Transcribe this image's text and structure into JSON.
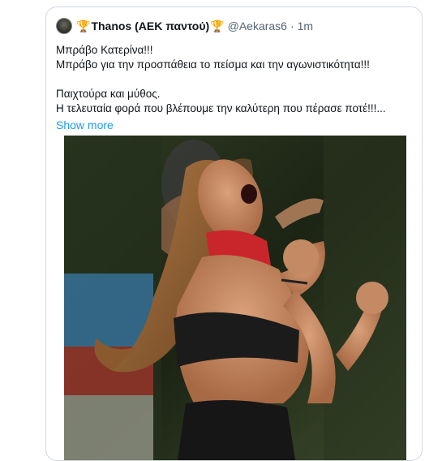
{
  "tweet": {
    "author": {
      "display_name": "Thanos (ΑΕΚ παντού)",
      "emoji_left": "🏆",
      "emoji_right": "🏆",
      "handle": "@Aekaras6",
      "separator": "·",
      "time": "1m"
    },
    "text_lines": [
      "Μπράβο Κατερίνα!!!",
      "Μπράβο για την προσπάθεια το πείσμα και την αγωνιστικότητα!!!",
      "Παιχτούρα και μύθος.",
      "Η τελευταία φορά που βλέπουμε την καλύτερη που πέρασε ποτέ!!!..."
    ],
    "show_more_label": "Show more",
    "media": {
      "kind": "photo",
      "description_icon": "photo"
    }
  }
}
